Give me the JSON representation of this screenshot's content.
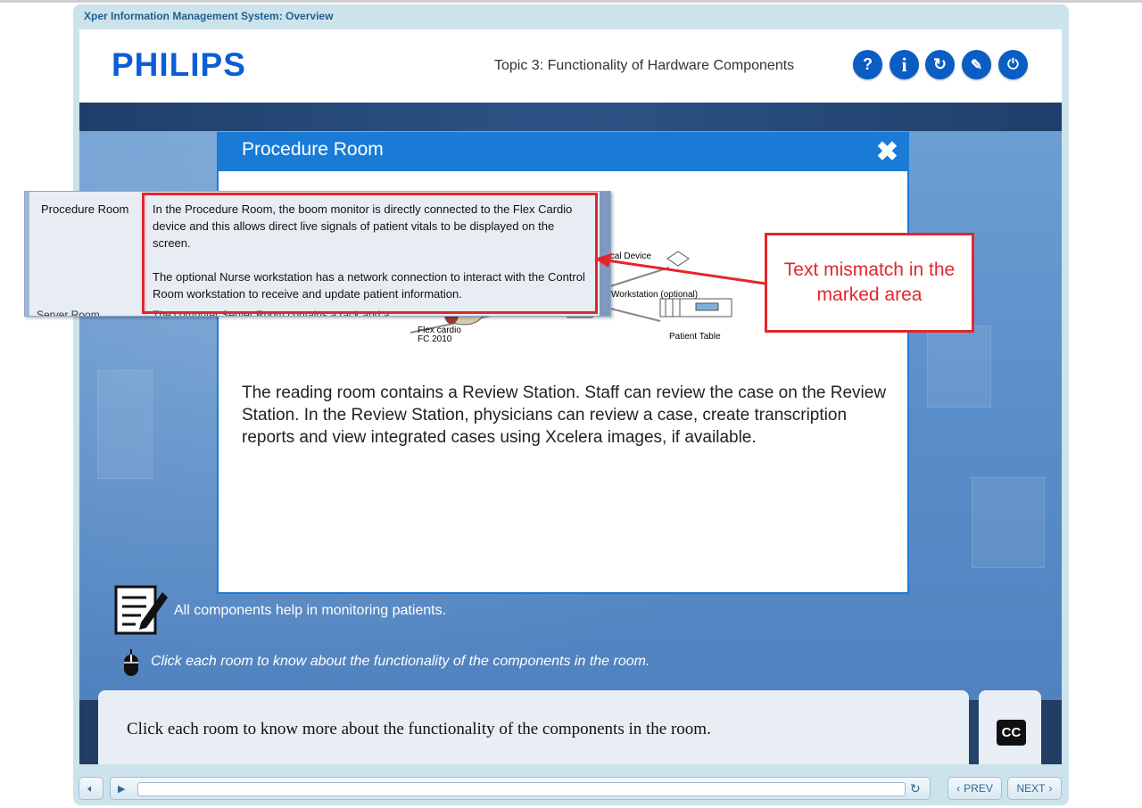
{
  "window": {
    "title": "Xper Information Management System: Overview"
  },
  "header": {
    "logo": "PHILIPS",
    "topic": "Topic 3: Functionality of Hardware Components",
    "buttons": [
      {
        "name": "help-button",
        "glyph": "?"
      },
      {
        "name": "info-button",
        "glyph": "i"
      },
      {
        "name": "replay-button",
        "glyph": "↻"
      },
      {
        "name": "glossary-button",
        "glyph": "✎"
      },
      {
        "name": "exit-button",
        "glyph": "⏻"
      }
    ]
  },
  "modal": {
    "title": "Procedure Room",
    "close_glyph": "✖",
    "body": "The reading room contains a Review Station. Staff can review the case on the Review Station. In the Review Station, physicians can review a case, create transcription reports and view integrated cases using Xcelera images, if available.",
    "diagram_labels": {
      "medical_device": "dical Device",
      "workstation": "Workstation (optional)",
      "flex_cardio": "Flex cardio",
      "fc_model": "FC 2010",
      "patient_table": "Patient Table"
    }
  },
  "popup": {
    "row_label": "Procedure Room",
    "paragraph1": "In the Procedure Room, the boom monitor is directly connected to the Flex Cardio device and this allows direct live signals of patient vitals to be displayed on the screen.",
    "paragraph2": "The optional Nurse workstation has a network connection to interact with the Control Room workstation to receive and update patient information.",
    "next_row_label": "Server Room",
    "next_row_text": "The computer Server Room contains a rack and a"
  },
  "annotation": {
    "callout": "Text mismatch in the marked area",
    "color": "#e3262b"
  },
  "notes": {
    "note": "All components help in monitoring patients.",
    "instruction": "Click each room to know about the functionality of the components in the room."
  },
  "caption": {
    "text": "Click each room to know more about the functionality of the components in the room.",
    "cc_label": "CC"
  },
  "controls": {
    "prev": "PREV",
    "next": "NEXT"
  },
  "colors": {
    "accent": "#1a7bd6",
    "brand": "#0b5ed7"
  }
}
